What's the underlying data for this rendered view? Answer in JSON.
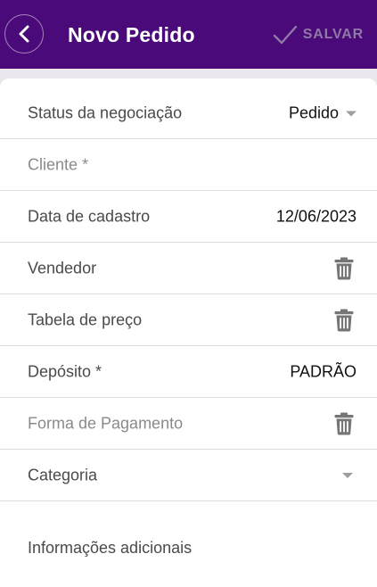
{
  "appbar": {
    "title": "Novo Pedido",
    "back_icon": "chevron-left-icon",
    "save_label": "SALVAR",
    "save_icon": "check-icon",
    "background_color": "#4a0a7a"
  },
  "form": {
    "status": {
      "label": "Status da negociação",
      "value": "Pedido"
    },
    "cliente": {
      "label": "Cliente *"
    },
    "data_cadastro": {
      "label": "Data de cadastro",
      "value": "12/06/2023"
    },
    "vendedor": {
      "label": "Vendedor",
      "action_icon": "trash-icon"
    },
    "tabela_preco": {
      "label": "Tabela de preço",
      "action_icon": "trash-icon"
    },
    "deposito": {
      "label": "Depósito *",
      "value": "PADRÃO"
    },
    "forma_pagamento": {
      "label": "Forma de Pagamento",
      "action_icon": "trash-icon"
    },
    "categoria": {
      "label": "Categoria"
    },
    "info_adicionais": {
      "label": "Informações adicionais"
    }
  }
}
